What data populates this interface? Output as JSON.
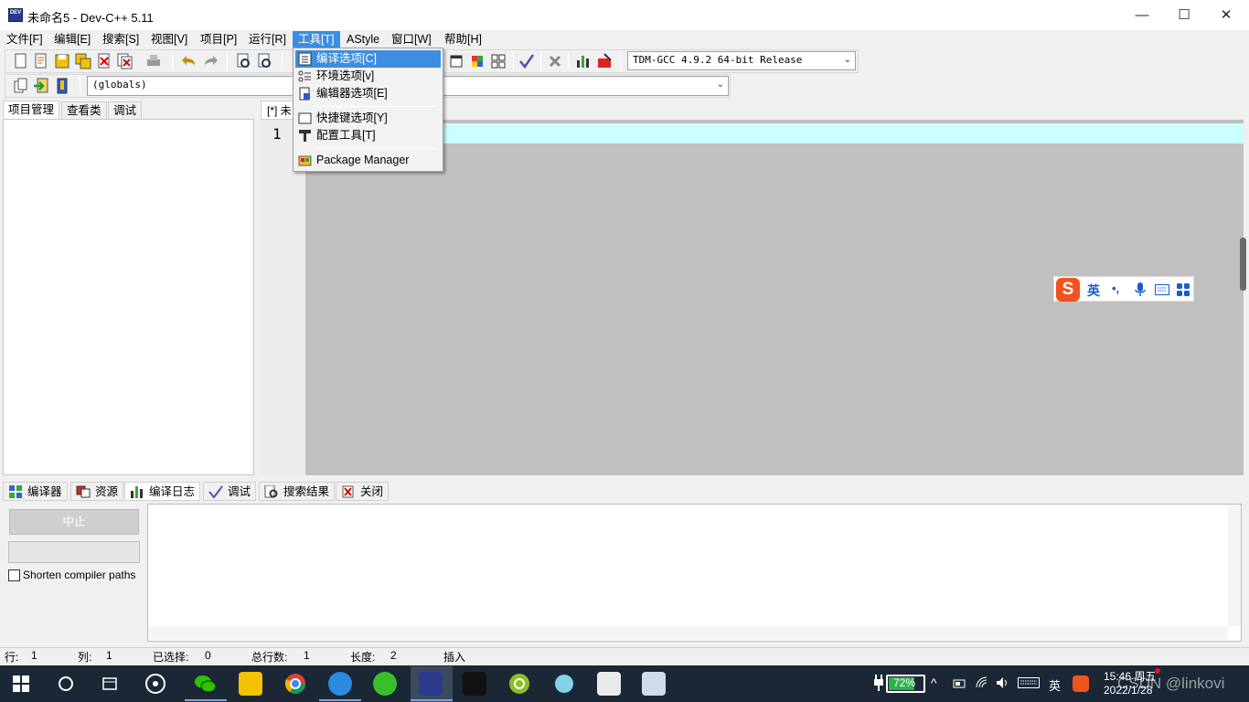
{
  "window": {
    "title": "未命名5 - Dev-C++ 5.11",
    "app_icon_text": "DEV",
    "minimize": "—",
    "maximize": "☐",
    "close": "✕"
  },
  "menu": [
    "文件[F]",
    "编辑[E]",
    "搜索[S]",
    "视图[V]",
    "项目[P]",
    "运行[R]",
    "工具[T]",
    "AStyle",
    "窗口[W]",
    "帮助[H]"
  ],
  "toolbar": {
    "compiler_select": "TDM-GCC 4.9.2 64-bit Release",
    "scope_select": "(globals)"
  },
  "dropdown": {
    "items": [
      "编译选项[C]",
      "环境选项[v]",
      "编辑器选项[E]",
      "快捷键选项[Y]",
      "配置工具[T]",
      "Package Manager"
    ]
  },
  "left_tabs": [
    "项目管理",
    "查看类",
    "调试"
  ],
  "editor": {
    "tab_label": "[*] 未",
    "line_number": "1"
  },
  "ime": {
    "lang": "英",
    "punct": "•,",
    "logo": "S"
  },
  "bottom_tabs": [
    "编译器",
    "资源",
    "编译日志",
    "调试",
    "搜索结果",
    "关闭"
  ],
  "bottom_panel": {
    "abort_button": "中止",
    "shorten_checkbox": "Shorten compiler paths"
  },
  "status": {
    "row_label": "行:",
    "row_value": "1",
    "col_label": "列:",
    "col_value": "1",
    "sel_label": "已选择:",
    "sel_value": "0",
    "lines_label": "总行数:",
    "lines_value": "1",
    "len_label": "长度:",
    "len_value": "2",
    "mode": "插入"
  },
  "taskbar": {
    "battery": "72%",
    "lang": "英",
    "time": "15:46 周五",
    "date": "2022/1/28",
    "watermark": "CSDN @linkovi"
  },
  "colors": {
    "highlight": "#3d8ee0",
    "current_line": "#ccffff",
    "editor_bg": "#c0c0c0",
    "taskbar": "#1c2736"
  }
}
